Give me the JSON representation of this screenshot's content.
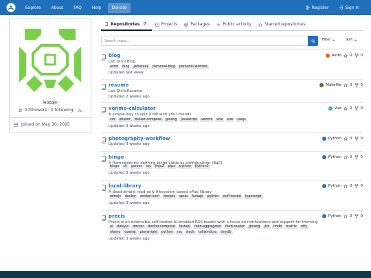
{
  "nav": {
    "items": [
      "Explore",
      "About",
      "FAQ",
      "Help",
      "Donate"
    ],
    "register": "Register",
    "signin": "Sign In"
  },
  "profile": {
    "username": "leozqin",
    "followers": "0 followers · 0 following",
    "joined": "Joined on May 30, 2025",
    "avatar_color": "#7ad04a"
  },
  "tabs": [
    {
      "label": "Repositories",
      "count": "7"
    },
    {
      "label": "Projects"
    },
    {
      "label": "Packages"
    },
    {
      "label": "Public activity"
    },
    {
      "label": "Starred repositories"
    }
  ],
  "search": {
    "placeholder": "Search repos..."
  },
  "filter_label": "Filter",
  "sort_label": "Sort",
  "repos": [
    {
      "name": "blog",
      "desc": "Léo Qin's Blog",
      "topics": [
        "astro",
        "blog",
        "jamstack",
        "personal-blog",
        "personal-website"
      ],
      "updated": "Updated last week",
      "lang": "Astro",
      "lang_color": "#ff5a03",
      "stars": "0",
      "forks": "0"
    },
    {
      "name": "resume",
      "desc": "Leo Qin's Resume",
      "topics": [],
      "updated": "Updated 2 weeks ago",
      "lang": "Makefile",
      "lang_color": "#427819",
      "stars": "0",
      "forks": "0"
    },
    {
      "name": "venmo-calculator",
      "desc": "A simple way to split a bill with your friends",
      "topics": [
        "css",
        "docker",
        "docker-compose",
        "golang",
        "javascript",
        "venmo",
        "vite",
        "vue",
        "vuejs"
      ],
      "updated": "Updated 3 weeks ago",
      "lang": "Vue",
      "lang_color": "#41b883",
      "stars": "0",
      "forks": "0"
    },
    {
      "name": "photography-workflow",
      "desc": "",
      "topics": [],
      "updated": "Updated 3 weeks ago",
      "lang": "Python",
      "lang_color": "#3572a5",
      "stars": "0",
      "forks": "0"
    },
    {
      "name": "bingo",
      "desc": "A framework for defining bingo cards as configuration (BaC)",
      "topics": [
        "bingo",
        "cli",
        "games",
        "iac",
        "jinja2",
        "pipx",
        "python",
        "python3"
      ],
      "updated": "Updated 3 weeks ago",
      "lang": "Python",
      "lang_color": "#3572a5",
      "stars": "0",
      "forks": "0"
    },
    {
      "name": "local-library",
      "desc": "A dead-simple read-only filesystem based ePub library",
      "topics": [
        "astrojs",
        "docker",
        "docker-com",
        "ebooks",
        "epub",
        "fastapi",
        "python",
        "self-hosted",
        "typescript"
      ],
      "updated": "Updated 3 weeks ago",
      "lang": "Python",
      "lang_color": "#3572a5",
      "stars": "0",
      "forks": "0"
    },
    {
      "name": "precis",
      "desc": "Precis is an extensible self-hosted AI-enabled RSS reader with a focus on notifications and support for theming",
      "topics": [
        "ai",
        "daisyui",
        "docker",
        "docker-compose",
        "fastapi",
        "feed-aggregator",
        "feed-reader",
        "golang",
        "jira",
        "lmdb",
        "matrix",
        "ntfy",
        "nfamu",
        "openai",
        "playwright",
        "python",
        "rss",
        "slack",
        "tailwindcss",
        "tinydb"
      ],
      "updated": "Updated 3 weeks ago",
      "lang": "Python",
      "lang_color": "#3572a5",
      "stars": "0",
      "forks": "0"
    }
  ]
}
